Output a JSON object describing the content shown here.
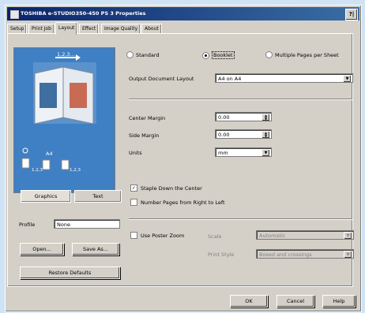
{
  "window": {
    "title": "TOSHIBA e-STUDIO350-450 PS 3 Properties",
    "help_label": "?|"
  },
  "tabs": [
    {
      "label": "Setup"
    },
    {
      "label": "Print Job"
    },
    {
      "label": "Layout"
    },
    {
      "label": "Effect"
    },
    {
      "label": "Image Quality"
    },
    {
      "label": "About"
    }
  ],
  "preview": {
    "page_label": "1,2,3...",
    "paper_size": "A4",
    "copies_a": "1,2,3",
    "copies_b": "1,2,3"
  },
  "view_tabs": {
    "graphics": "Graphics",
    "text": "Text"
  },
  "profile": {
    "label": "Profile",
    "value": "None"
  },
  "buttons": {
    "open": "Open...",
    "save_as": "Save As...",
    "restore": "Restore Defaults",
    "ok": "OK",
    "cancel": "Cancel",
    "help": "Help"
  },
  "layout_mode": {
    "standard": "Standard",
    "booklet": "Booklet",
    "multiple": "Multiple Pages per Sheet"
  },
  "output_layout": {
    "label": "Output Document Layout",
    "value": "A4 on A4"
  },
  "center_margin": {
    "label": "Center Margin",
    "value": "0.00"
  },
  "side_margin": {
    "label": "Side Margin",
    "value": "0.00"
  },
  "units": {
    "label": "Units",
    "value": "mm"
  },
  "staple_center": "Staple Down the Center",
  "number_rtl": "Number Pages from Right to Left",
  "poster": {
    "label": "Use Poster Zoom",
    "scale_label": "Scale",
    "scale_value": "Automatic",
    "print_style_label": "Print Style",
    "print_style_value": "Boxed and crossings"
  }
}
